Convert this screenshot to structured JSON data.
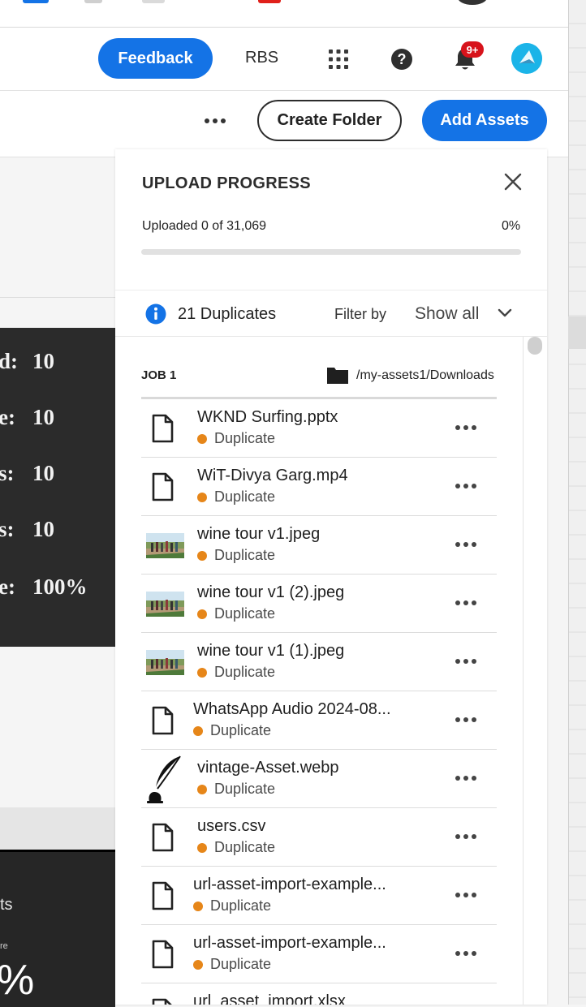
{
  "header": {
    "feedback_label": "Feedback",
    "org_label": "RBS",
    "notification_badge": "9+",
    "accent_color": "#1473e6",
    "badge_color": "#d7131b"
  },
  "toolbar": {
    "create_folder_label": "Create Folder",
    "add_assets_label": "Add Assets"
  },
  "background": {
    "stats": [
      {
        "key": "d:",
        "value": "10"
      },
      {
        "key": "e:",
        "value": "10"
      },
      {
        "key": "s:",
        "value": "10"
      },
      {
        "key": "s:",
        "value": "10"
      },
      {
        "key": "e:",
        "value": "100%"
      }
    ],
    "card_label": "ts",
    "card_sub": "re",
    "card_big": "%"
  },
  "upload": {
    "title": "UPLOAD PROGRESS",
    "uploaded_text": "Uploaded 0 of 31,069",
    "percent_text": "0%",
    "progress_fraction": 0,
    "duplicates_text": "21 Duplicates",
    "filter_label": "Filter by",
    "filter_value": "Show all",
    "job_label": "JOB 1",
    "job_path": "/my-assets1/Downloads",
    "status_color": "#e68619",
    "files": [
      {
        "name": "WKND Surfing.pptx",
        "status": "Duplicate",
        "icon": "file-icon"
      },
      {
        "name": "WiT-Divya Garg.mp4",
        "status": "Duplicate",
        "icon": "file-icon"
      },
      {
        "name": "wine tour v1.jpeg",
        "status": "Duplicate",
        "icon": "image-thumbnail"
      },
      {
        "name": "wine tour v1 (2).jpeg",
        "status": "Duplicate",
        "icon": "image-thumbnail"
      },
      {
        "name": "wine tour v1 (1).jpeg",
        "status": "Duplicate",
        "icon": "image-thumbnail"
      },
      {
        "name": "WhatsApp Audio 2024-08...",
        "status": "Duplicate",
        "icon": "file-icon"
      },
      {
        "name": "vintage-Asset.webp",
        "status": "Duplicate",
        "icon": "quill-thumbnail"
      },
      {
        "name": "users.csv",
        "status": "Duplicate",
        "icon": "file-icon"
      },
      {
        "name": "url-asset-import-example...",
        "status": "Duplicate",
        "icon": "file-icon"
      },
      {
        "name": "url-asset-import-example...",
        "status": "Duplicate",
        "icon": "file-icon"
      },
      {
        "name": "url_asset_import.xlsx",
        "status": "",
        "icon": "file-icon"
      }
    ]
  }
}
